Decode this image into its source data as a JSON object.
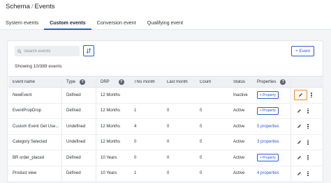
{
  "breadcrumb": {
    "root": "Schema",
    "separator": "/",
    "current": "Events"
  },
  "tabs": [
    "System events",
    "Custom events",
    "Conversion event",
    "Qualifying event"
  ],
  "active_tab": "Custom events",
  "search": {
    "placeholder": "Search events"
  },
  "add_event_label": "Event",
  "showing_text": "Showing 10/389 events",
  "columns": [
    "Event name",
    "Type",
    "DRP",
    "This month",
    "Last month",
    "Count",
    "Status",
    "Properties"
  ],
  "rows": [
    {
      "name": "NewEvent",
      "type": "Defined",
      "drp": "12 Months",
      "this_month": "",
      "last_month": "",
      "count": "",
      "status": "Inactive",
      "properties": "Property",
      "prop_kind": "button"
    },
    {
      "name": "EventPropDrop",
      "type": "Defined",
      "drp": "12 Months",
      "this_month": "1",
      "last_month": "0",
      "count": "0",
      "status": "Active",
      "properties": "Property",
      "prop_kind": "button"
    },
    {
      "name": "Custom Event Get Use...",
      "type": "Undefined",
      "drp": "12 Months",
      "this_month": "4",
      "last_month": "0",
      "count": "0",
      "status": "Active",
      "properties": "5 properties",
      "prop_kind": "link"
    },
    {
      "name": "Category Selected",
      "type": "Undefined",
      "drp": "12 Months",
      "this_month": "0",
      "last_month": "0",
      "count": "0",
      "status": "Active",
      "properties": "3 properties",
      "prop_kind": "link"
    },
    {
      "name": "BR order_placed",
      "type": "Defined",
      "drp": "10 Years",
      "this_month": "0",
      "last_month": "0",
      "count": "0",
      "status": "Active",
      "properties": "Property",
      "prop_kind": "button"
    },
    {
      "name": "Product view",
      "type": "Defined",
      "drp": "10 Years",
      "this_month": "1",
      "last_month": "0",
      "count": "0",
      "status": "Active",
      "properties": "4 properties",
      "prop_kind": "link"
    }
  ],
  "colors": {
    "accent": "#2f5bd3",
    "highlight": "#f08a24"
  }
}
